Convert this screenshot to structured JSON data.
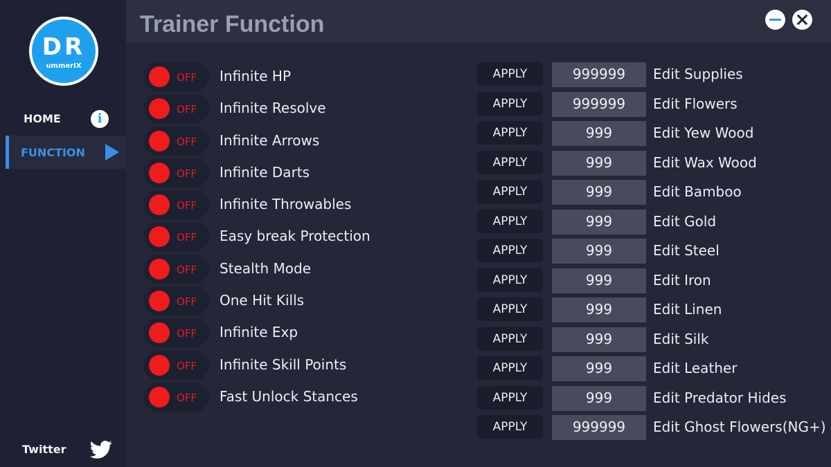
{
  "sidebar": {
    "logo": {
      "initials": "DR",
      "subtitle": "ummerIX"
    },
    "nav": [
      {
        "label": "HOME",
        "icon": "info-icon"
      },
      {
        "label": "FUNCTION",
        "icon": "play-icon"
      }
    ],
    "twitter_label": "Twitter"
  },
  "header": {
    "title": "Trainer Function"
  },
  "colors": {
    "accent": "#3b8fe6",
    "logo_blue": "#1ea0ee",
    "toggle_off": "#ee1c1c",
    "background": "#232738"
  },
  "toggles": [
    {
      "label": "Infinite HP",
      "state": "OFF"
    },
    {
      "label": "Infinite Resolve",
      "state": "OFF"
    },
    {
      "label": "Infinite Arrows",
      "state": "OFF"
    },
    {
      "label": "Infinite Darts",
      "state": "OFF"
    },
    {
      "label": "Infinite Throwables",
      "state": "OFF"
    },
    {
      "label": "Easy break Protection",
      "state": "OFF"
    },
    {
      "label": "Stealth Mode",
      "state": "OFF"
    },
    {
      "label": "One Hit Kills",
      "state": "OFF"
    },
    {
      "label": "Infinite Exp",
      "state": "OFF"
    },
    {
      "label": "Infinite Skill Points",
      "state": "OFF"
    },
    {
      "label": "Fast Unlock Stances",
      "state": "OFF"
    }
  ],
  "edits": [
    {
      "button": "APPLY",
      "value": "999999",
      "label": "Edit Supplies"
    },
    {
      "button": "APPLY",
      "value": "999999",
      "label": "Edit Flowers"
    },
    {
      "button": "APPLY",
      "value": "999",
      "label": "Edit Yew Wood"
    },
    {
      "button": "APPLY",
      "value": "999",
      "label": "Edit Wax Wood"
    },
    {
      "button": "APPLY",
      "value": "999",
      "label": "Edit Bamboo"
    },
    {
      "button": "APPLY",
      "value": "999",
      "label": "Edit Gold"
    },
    {
      "button": "APPLY",
      "value": "999",
      "label": "Edit Steel"
    },
    {
      "button": "APPLY",
      "value": "999",
      "label": "Edit Iron"
    },
    {
      "button": "APPLY",
      "value": "999",
      "label": "Edit Linen"
    },
    {
      "button": "APPLY",
      "value": "999",
      "label": "Edit Silk"
    },
    {
      "button": "APPLY",
      "value": "999",
      "label": "Edit Leather"
    },
    {
      "button": "APPLY",
      "value": "999",
      "label": "Edit Predator Hides"
    },
    {
      "button": "APPLY",
      "value": "999999",
      "label": "Edit Ghost Flowers(NG+)"
    }
  ]
}
